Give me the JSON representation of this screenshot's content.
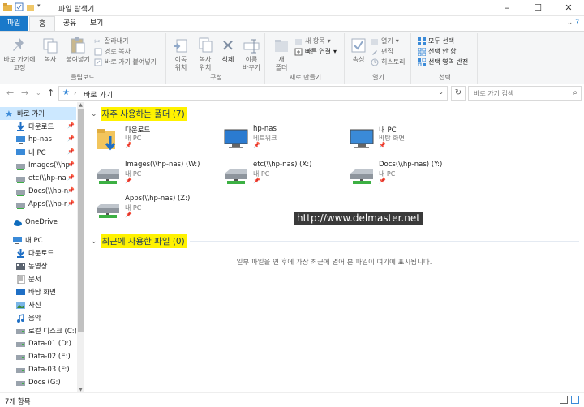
{
  "window": {
    "title": "파일 탐색기"
  },
  "ribbon_tabs": [
    "파일",
    "홈",
    "공유",
    "보기"
  ],
  "ribbon": {
    "clipboard": {
      "pin_label": "바로 가기에\n고정",
      "copy_label": "복사",
      "paste_label": "붙여넣기",
      "cut_label": "잘라내기",
      "copy_path_label": "경로 복사",
      "paste_shortcut_label": "바로 가기 붙여넣기",
      "group_label": "클립보드"
    },
    "organize": {
      "move_label": "이동\n위치",
      "copy_label": "복사\n위치",
      "delete_label": "삭제",
      "rename_label": "이름\n바꾸기",
      "group_label": "구성"
    },
    "new": {
      "new_folder_label": "새\n폴더",
      "new_item_label": "새 항목",
      "easy_access_label": "빠른 연결",
      "group_label": "새로 만들기"
    },
    "open": {
      "properties_label": "속성",
      "open_label": "열기",
      "edit_label": "편집",
      "history_label": "히스토리",
      "group_label": "열기"
    },
    "select": {
      "select_all_label": "모두 선택",
      "select_none_label": "선택 안 함",
      "invert_label": "선택 영역 반전",
      "group_label": "선택"
    }
  },
  "address": {
    "crumb": "바로 가기",
    "search_placeholder": "바로 가기 검색"
  },
  "nav": {
    "quick_access": "바로 가기",
    "items": [
      {
        "label": "다운로드",
        "icon": "download-icon",
        "pinned": true
      },
      {
        "label": "hp-nas",
        "icon": "monitor-icon",
        "pinned": true
      },
      {
        "label": "내 PC",
        "icon": "monitor-icon",
        "pinned": true
      },
      {
        "label": "Images(\\\\hp",
        "icon": "drive-icon",
        "pinned": true
      },
      {
        "label": "etc(\\\\hp-na",
        "icon": "drive-icon",
        "pinned": true
      },
      {
        "label": "Docs(\\\\hp-n",
        "icon": "drive-icon",
        "pinned": true
      },
      {
        "label": "Apps(\\\\hp-r",
        "icon": "drive-icon",
        "pinned": true
      }
    ],
    "onedrive": "OneDrive",
    "this_pc": "내 PC",
    "pc_items": [
      {
        "label": "다운로드",
        "icon": "download-icon"
      },
      {
        "label": "동영상",
        "icon": "video-icon"
      },
      {
        "label": "문서",
        "icon": "document-icon"
      },
      {
        "label": "바탕 화면",
        "icon": "desktop-icon"
      },
      {
        "label": "사진",
        "icon": "picture-icon"
      },
      {
        "label": "음악",
        "icon": "music-icon"
      },
      {
        "label": "로컬 디스크 (C:)",
        "icon": "disk-icon"
      },
      {
        "label": "Data-01 (D:)",
        "icon": "disk-icon"
      },
      {
        "label": "Data-02 (E:)",
        "icon": "disk-icon"
      },
      {
        "label": "Data-03 (F:)",
        "icon": "disk-icon"
      },
      {
        "label": "Docs (G:)",
        "icon": "disk-icon"
      }
    ]
  },
  "frequent": {
    "title": "자주 사용하는 폴더 (7)",
    "items": [
      {
        "name": "다운로드",
        "sub": "내 PC",
        "icon": "download-folder-icon"
      },
      {
        "name": "hp-nas",
        "sub": "네트워크",
        "icon": "network-computer-icon"
      },
      {
        "name": "내 PC",
        "sub": "바탕 화면",
        "icon": "computer-icon"
      },
      {
        "name": "Images(\\\\hp-nas) (W:)",
        "sub": "내 PC",
        "icon": "network-drive-icon"
      },
      {
        "name": "etc(\\\\hp-nas) (X:)",
        "sub": "내 PC",
        "icon": "network-drive-icon"
      },
      {
        "name": "Docs(\\\\hp-nas) (Y:)",
        "sub": "내 PC",
        "icon": "network-drive-icon"
      },
      {
        "name": "Apps(\\\\hp-nas) (Z:)",
        "sub": "내 PC",
        "icon": "network-drive-icon"
      }
    ]
  },
  "recent": {
    "title": "최근에 사용한 파일 (0)",
    "empty_text": "일부 파일을 연 후에 가장 최근에 열어 본 파일이 여기에 표시됩니다."
  },
  "watermark": "http://www.delmaster.net",
  "status": {
    "count": "7개 항목"
  },
  "colors": {
    "accent": "#1979ca",
    "highlight": "#fff200",
    "selected": "#cce8ff"
  }
}
